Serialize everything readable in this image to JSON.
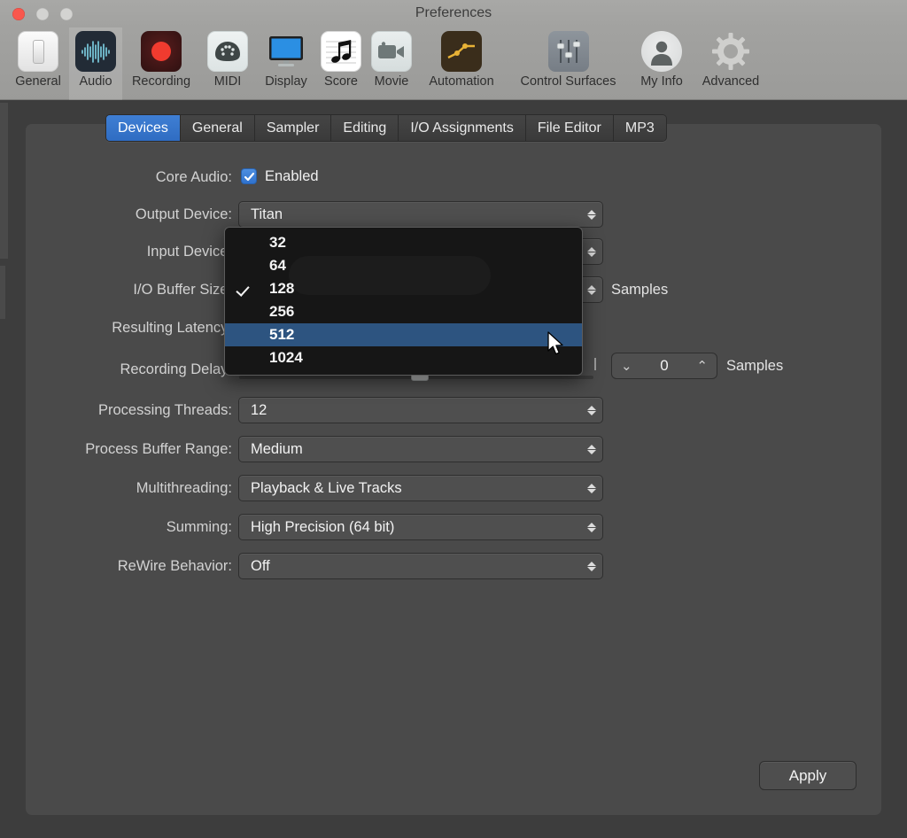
{
  "window": {
    "title": "Preferences",
    "traffic_lights": [
      "close",
      "minimize",
      "zoom"
    ]
  },
  "toolbar": {
    "items": [
      {
        "label": "General",
        "icon": "general-icon",
        "selected": false
      },
      {
        "label": "Audio",
        "icon": "audio-waveform-icon",
        "selected": true
      },
      {
        "label": "Recording",
        "icon": "record-icon",
        "selected": false
      },
      {
        "label": "MIDI",
        "icon": "midi-icon",
        "selected": false
      },
      {
        "label": "Display",
        "icon": "display-monitor-icon",
        "selected": false
      },
      {
        "label": "Score",
        "icon": "score-note-icon",
        "selected": false
      },
      {
        "label": "Movie",
        "icon": "movie-camera-icon",
        "selected": false
      },
      {
        "label": "Automation",
        "icon": "automation-curve-icon",
        "selected": false
      },
      {
        "label": "Control Surfaces",
        "icon": "faders-icon",
        "selected": false
      },
      {
        "label": "My Info",
        "icon": "person-icon",
        "selected": false
      },
      {
        "label": "Advanced",
        "icon": "gear-icon",
        "selected": false
      }
    ]
  },
  "tabs": [
    {
      "label": "Devices",
      "active": true
    },
    {
      "label": "General",
      "active": false
    },
    {
      "label": "Sampler",
      "active": false
    },
    {
      "label": "Editing",
      "active": false
    },
    {
      "label": "I/O Assignments",
      "active": false
    },
    {
      "label": "File Editor",
      "active": false
    },
    {
      "label": "MP3",
      "active": false
    }
  ],
  "form": {
    "core_audio": {
      "label": "Core Audio:",
      "checkbox_label": "Enabled",
      "checked": true
    },
    "output_device": {
      "label": "Output Device:",
      "value": "Titan"
    },
    "input_device": {
      "label": "Input Device:",
      "value": ""
    },
    "io_buffer_size": {
      "label": "I/O Buffer Size:",
      "value": "",
      "unit": "Samples"
    },
    "resulting_latency": {
      "label": "Resulting Latency:",
      "value": ""
    },
    "recording_delay": {
      "label": "Recording Delay:",
      "stepper_value": "0",
      "unit": "Samples"
    },
    "processing_threads": {
      "label": "Processing Threads:",
      "value": "12"
    },
    "process_buffer_range": {
      "label": "Process Buffer Range:",
      "value": "Medium"
    },
    "multithreading": {
      "label": "Multithreading:",
      "value": "Playback & Live Tracks"
    },
    "summing": {
      "label": "Summing:",
      "value": "High Precision (64 bit)"
    },
    "rewire_behavior": {
      "label": "ReWire Behavior:",
      "value": "Off"
    }
  },
  "dropdown_menu": {
    "open": true,
    "owner": "io-buffer-size",
    "items": [
      {
        "label": "32",
        "checked": false,
        "highlighted": false
      },
      {
        "label": "64",
        "checked": false,
        "highlighted": false
      },
      {
        "label": "128",
        "checked": true,
        "highlighted": false
      },
      {
        "label": "256",
        "checked": false,
        "highlighted": false
      },
      {
        "label": "512",
        "checked": false,
        "highlighted": true
      },
      {
        "label": "1024",
        "checked": false,
        "highlighted": false
      }
    ]
  },
  "apply_button": {
    "label": "Apply"
  },
  "colors": {
    "accent_blue": "#3f7fd4",
    "menu_highlight": "#2d5480",
    "panel_bg": "#4a4a4a",
    "window_bg": "#3d3d3d",
    "titlebar_bg": "#a8a8a6",
    "menu_bg": "#161616",
    "close_button": "#f9574d"
  }
}
